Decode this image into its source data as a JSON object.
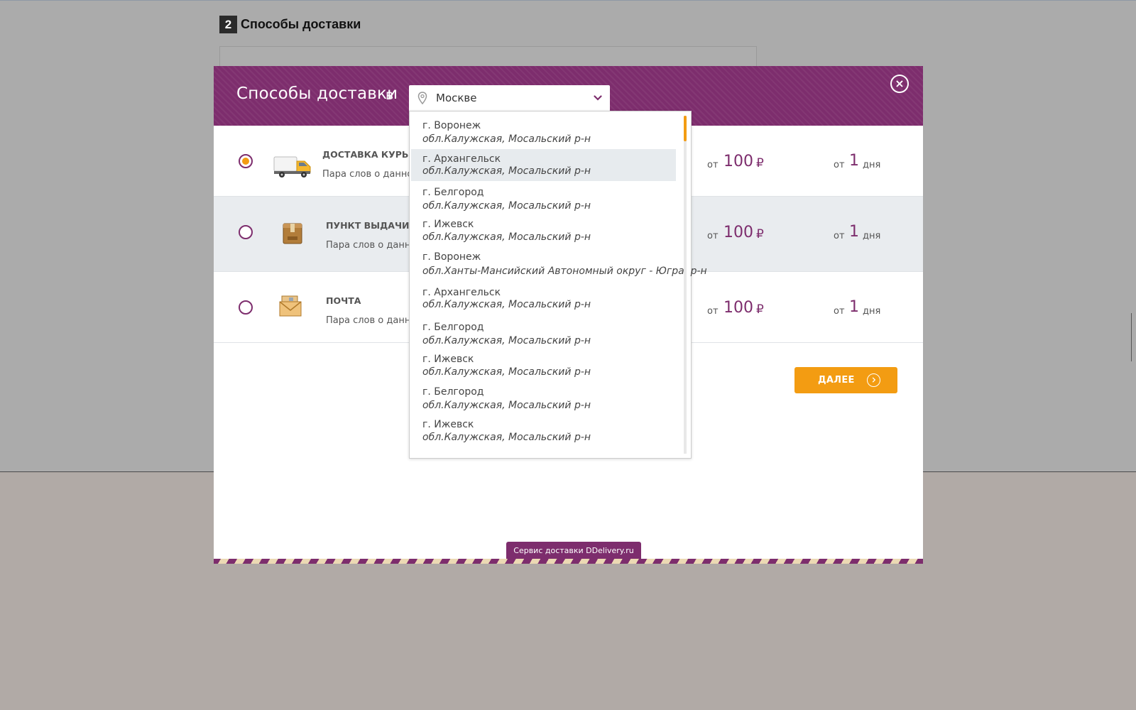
{
  "background": {
    "step_number": "2",
    "title": "Способы доставки"
  },
  "modal": {
    "title": "Способы доставки",
    "in_word": "в",
    "city_select": {
      "value": "Москве",
      "icon": "map-pin-icon",
      "chevron": "chevron-down-icon"
    },
    "close_icon": "close-icon",
    "close_glyph": "×",
    "methods": [
      {
        "name": "ДОСТАВКА КУРЬЕР",
        "description": "Пара слов о данном",
        "icon": "delivery-van-icon",
        "selected": true,
        "price_prefix": "от",
        "price": "100",
        "currency": "₽",
        "days_prefix": "от",
        "days": "1",
        "days_unit": "дня"
      },
      {
        "name": "ПУНКТ ВЫДАЧИ И.",
        "description": "Пара слов о данно",
        "icon": "parcel-box-icon",
        "selected": false,
        "price_prefix": "от",
        "price": "100",
        "currency": "₽",
        "days_prefix": "от",
        "days": "1",
        "days_unit": "дня"
      },
      {
        "name": "ПОЧТА",
        "description": "Пара слов о данно",
        "icon": "mail-envelope-icon",
        "selected": false,
        "price_prefix": "от",
        "price": "100",
        "currency": "₽",
        "days_prefix": "от",
        "days": "1",
        "days_unit": "дня"
      }
    ],
    "next_button": {
      "label": "ДАЛЕЕ",
      "icon": "arrow-right-circle-icon"
    },
    "footer": "Сервис доставки DDelivery.ru"
  },
  "dropdown": {
    "items": [
      {
        "city": "г. Воронеж",
        "region": "обл.Калужская, Мосальский р-н",
        "active": false
      },
      {
        "city": "г. Архангельск",
        "region": "обл.Калужская, Мосальский р-н",
        "active": true
      },
      {
        "city": "г. Белгород",
        "region": "обл.Калужская, Мосальский р-н",
        "active": false
      },
      {
        "city": "г. Ижевск",
        "region": "обл.Калужская, Мосальский р-н",
        "active": false
      },
      {
        "city": "г. Воронеж",
        "region": "обл.Ханты-Мансийский Автономный округ - Югра, р-н",
        "active": false
      },
      {
        "city": "г. Архангельск",
        "region": "обл.Калужская, Мосальский р-н",
        "active": false
      },
      {
        "city": "г. Белгород",
        "region": "обл.Калужская, Мосальский р-н",
        "active": false
      },
      {
        "city": "г. Ижевск",
        "region": "обл.Калужская, Мосальский р-н",
        "active": false
      },
      {
        "city": "г. Белгород",
        "region": "обл.Калужская, Мосальский р-н",
        "active": false
      },
      {
        "city": "г. Ижевск",
        "region": "обл.Калужская, Мосальский р-н",
        "active": false
      }
    ]
  },
  "colors": {
    "brand_purple": "#7d2d6d",
    "accent_orange": "#f39c12"
  }
}
